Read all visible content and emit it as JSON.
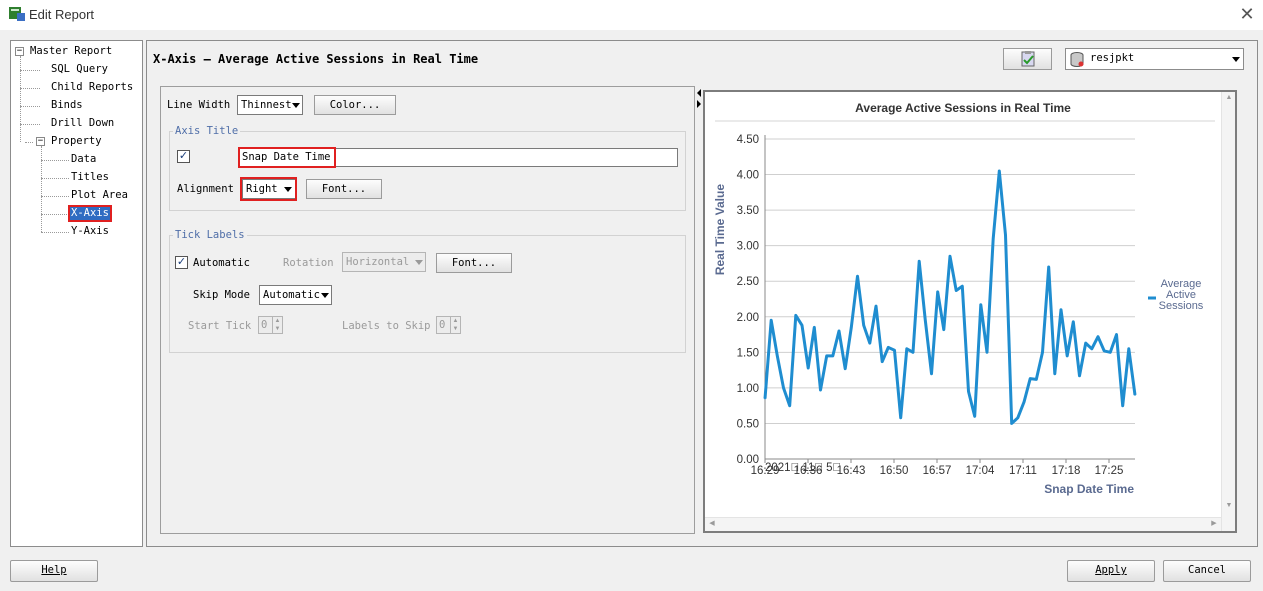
{
  "window": {
    "title": "Edit Report"
  },
  "tree": {
    "root": "Master Report",
    "children": [
      "SQL Query",
      "Child Reports",
      "Binds",
      "Drill Down",
      "Property"
    ],
    "property_children": [
      "Data",
      "Titles",
      "Plot Area",
      "X-Axis",
      "Y-Axis"
    ],
    "selected": "X-Axis"
  },
  "header": {
    "title": "X-Axis — Average Active Sessions in Real Time",
    "connection": "resjpkt"
  },
  "form": {
    "line_width_label": "Line Width",
    "line_width_value": "Thinnest",
    "color_button": "Color...",
    "axis_title_group": "Axis Title",
    "axis_title_checked": true,
    "axis_title_value": "Snap Date Time",
    "alignment_label": "Alignment",
    "alignment_value": "Right",
    "font_button": "Font...",
    "tick_labels_group": "Tick Labels",
    "automatic_checked": true,
    "automatic_label": "Automatic",
    "rotation_label": "Rotation",
    "rotation_value": "Horizontal",
    "tick_font_button": "Font...",
    "skip_mode_label": "Skip Mode",
    "skip_mode_value": "Automatic",
    "start_tick_label": "Start Tick",
    "start_tick_value": "0",
    "labels_to_skip_label": "Labels to Skip",
    "labels_to_skip_value": "0"
  },
  "buttons": {
    "help": "Help",
    "apply": "Apply",
    "cancel": "Cancel"
  },
  "colors": {
    "series": "#1f8dd0",
    "selected": "#2f6cc2",
    "highlight": "#e02020",
    "chart_title": "#333333",
    "axis_title": "#5a6a90"
  },
  "chart_data": {
    "type": "line",
    "title": "Average Active Sessions in Real Time",
    "xlabel": "Snap Date Time",
    "ylabel": "Real Time Value",
    "x_tick_labels": [
      "16:29",
      "16:36",
      "16:43",
      "16:50",
      "16:57",
      "17:04",
      "17:11",
      "17:18",
      "17:25"
    ],
    "x_sublabel": "2021\u0000 11\u0000 5\u0000",
    "ylim": [
      0,
      4.5
    ],
    "y_ticks": [
      "0.00",
      "0.50",
      "1.00",
      "1.50",
      "2.00",
      "2.50",
      "3.00",
      "3.50",
      "4.00",
      "4.50"
    ],
    "xlim": [
      0,
      60
    ],
    "legend": "right",
    "series": [
      {
        "name": "Average Active Sessions",
        "values": [
          0.85,
          1.95,
          1.45,
          1.0,
          0.75,
          2.02,
          1.88,
          1.28,
          1.85,
          0.97,
          1.45,
          1.45,
          1.8,
          1.27,
          1.85,
          2.57,
          1.88,
          1.63,
          2.15,
          1.37,
          1.57,
          1.53,
          0.58,
          1.55,
          1.5,
          2.78,
          1.95,
          1.2,
          2.35,
          1.82,
          2.85,
          2.37,
          2.43,
          0.95,
          0.6,
          2.17,
          1.5,
          3.1,
          4.05,
          3.15,
          0.5,
          0.58,
          0.8,
          1.13,
          1.12,
          1.5,
          2.7,
          1.2,
          2.1,
          1.45,
          1.93,
          1.17,
          1.63,
          1.55,
          1.72,
          1.52,
          1.5,
          1.75,
          0.75,
          1.55,
          0.9
        ]
      }
    ]
  }
}
